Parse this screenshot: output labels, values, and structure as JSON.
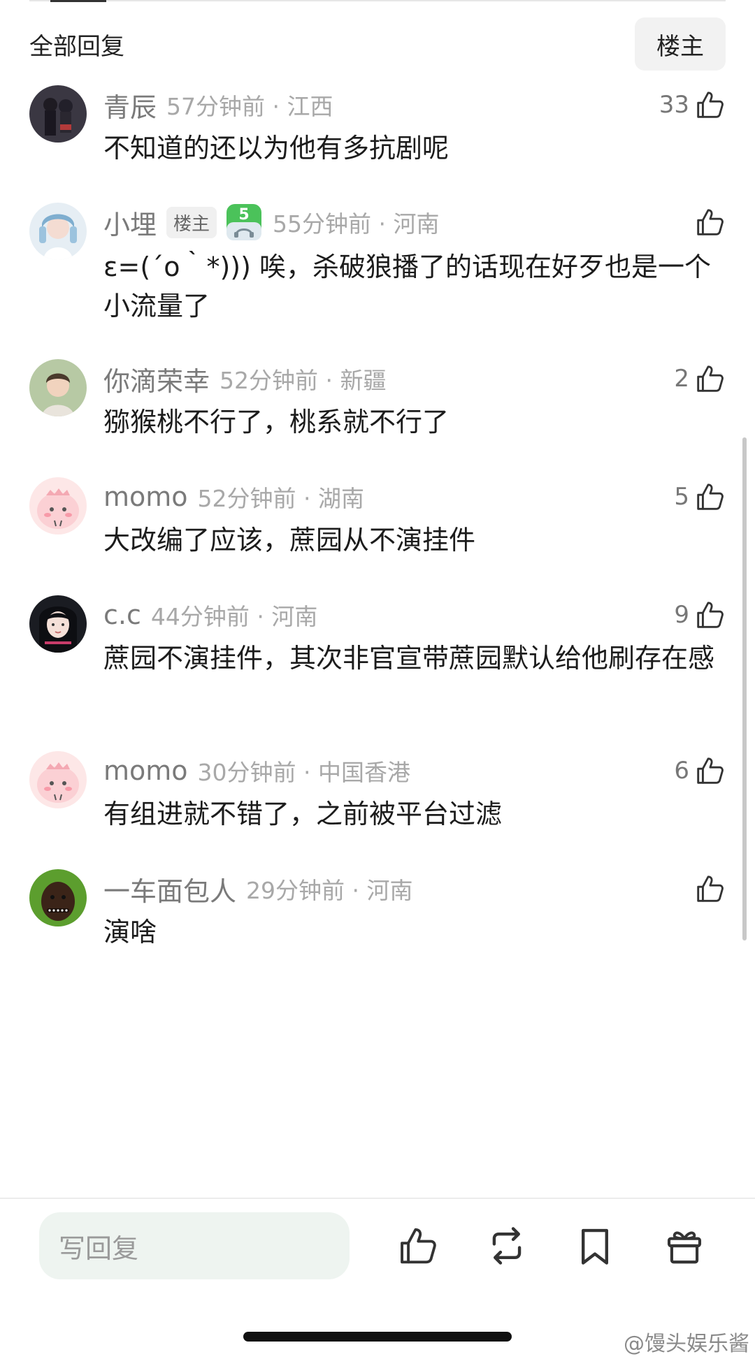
{
  "header": {
    "title": "全部回复",
    "op_filter": "楼主"
  },
  "comments": [
    {
      "user": "青辰",
      "time": "57分钟前 · 江西",
      "likes": "33",
      "text": "不知道的还以为他有多抗剧呢"
    },
    {
      "user": "小埋",
      "op_badge": "楼主",
      "level": "5",
      "time": "55分钟前 · 河南",
      "likes": "",
      "text": "ε=(´ο｀*))) 唉，杀破狼播了的话现在好歹也是一个小流量了"
    },
    {
      "user": "你滴荣幸",
      "time": "52分钟前 · 新疆",
      "likes": "2",
      "text": "猕猴桃不行了，桃系就不行了"
    },
    {
      "user": "momo",
      "time": "52分钟前 · 湖南",
      "likes": "5",
      "text": "大改编了应该，蔗园从不演挂件"
    },
    {
      "user": "c.c",
      "time": "44分钟前 · 河南",
      "likes": "9",
      "text": "蔗园不演挂件，其次非官宣带蔗园默认给他刷存在感"
    },
    {
      "user": "momo",
      "time": "30分钟前 · 中国香港",
      "likes": "6",
      "text": "有组进就不错了，之前被平台过滤"
    },
    {
      "user": "一车面包人",
      "time": "29分钟前 · 河南",
      "likes": "",
      "text": "演啥"
    }
  ],
  "bottom_bar": {
    "reply_placeholder": "写回复",
    "icons": [
      "thumbs-up-icon",
      "repost-icon",
      "bookmark-icon",
      "gift-icon"
    ]
  },
  "watermark": "@馒头娱乐酱"
}
